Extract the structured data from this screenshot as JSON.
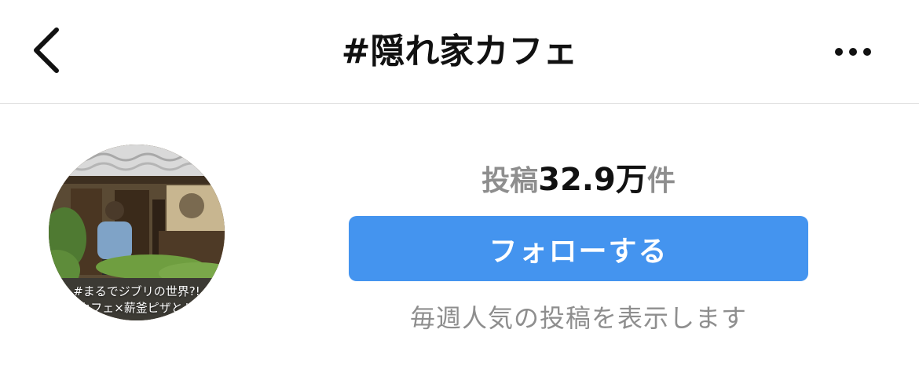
{
  "header": {
    "title": "#隠れ家カフェ",
    "back_icon": "chevron-left-icon",
    "more_icon": "more-horizontal-icon"
  },
  "profile": {
    "avatar_caption_line1": "#まるでジブリの世界?!",
    "avatar_caption_line2": "カフェ×薪釜ピザとド"
  },
  "stats": {
    "label": "投稿",
    "count": "32.9万",
    "unit": "件"
  },
  "actions": {
    "follow_label": "フォローする"
  },
  "footer_note": "毎週人気の投稿を表示します",
  "colors": {
    "accent": "#4494ef",
    "muted_text": "#8e8e8e",
    "divider": "#dcdcdc"
  }
}
